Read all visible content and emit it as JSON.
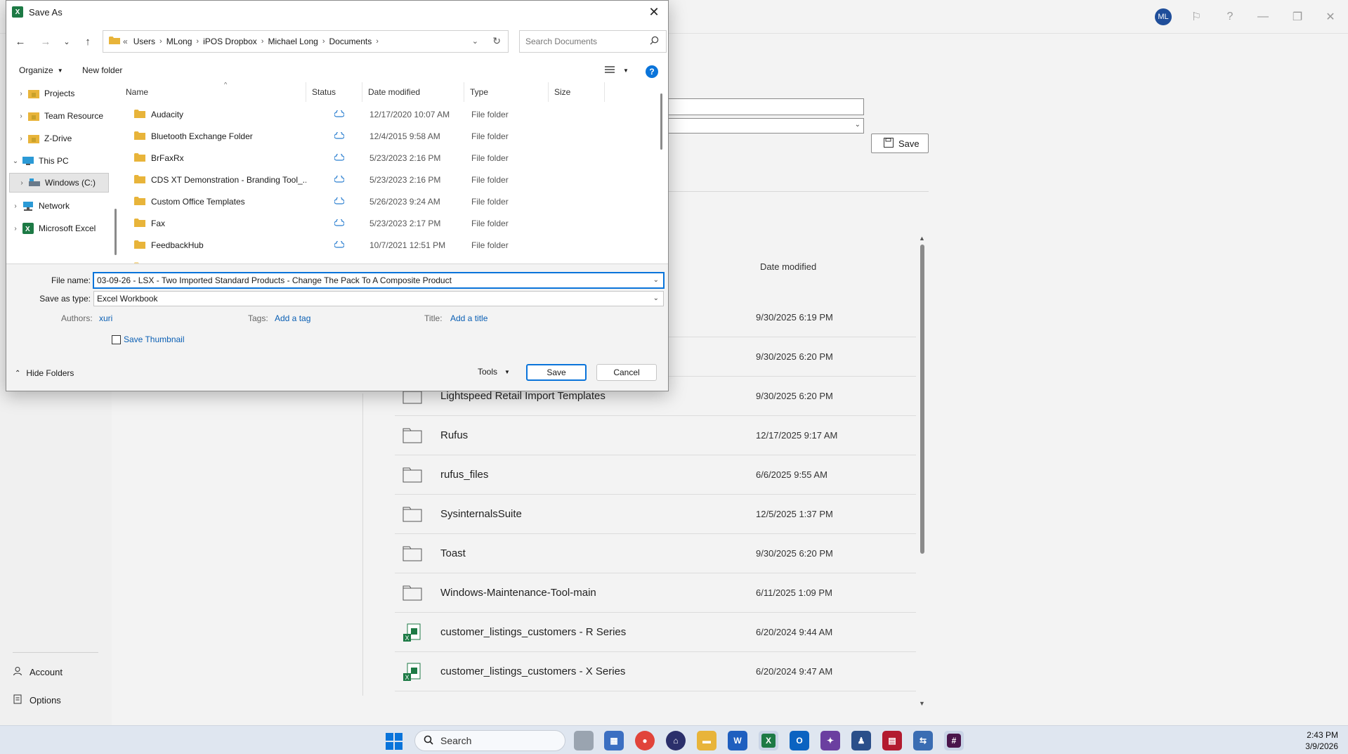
{
  "background": {
    "avatar_initials": "ML",
    "save_button": "Save",
    "date_header": "Date modified",
    "rows": [
      {
        "name": "",
        "date": "9/30/2025 6:19 PM",
        "icon": "folder-icon"
      },
      {
        "name": "",
        "date": "9/30/2025 6:20 PM",
        "icon": "folder-icon"
      },
      {
        "name": "Lightspeed Retail Import Templates",
        "date": "9/30/2025 6:20 PM",
        "icon": "folder-icon"
      },
      {
        "name": "Rufus",
        "date": "12/17/2025 9:17 AM",
        "icon": "folder-icon"
      },
      {
        "name": "rufus_files",
        "date": "6/6/2025 9:55 AM",
        "icon": "folder-icon"
      },
      {
        "name": "SysinternalsSuite",
        "date": "12/5/2025 1:37 PM",
        "icon": "folder-icon"
      },
      {
        "name": "Toast",
        "date": "9/30/2025 6:20 PM",
        "icon": "folder-icon"
      },
      {
        "name": "Windows-Maintenance-Tool-main",
        "date": "6/11/2025 1:09 PM",
        "icon": "folder-icon"
      },
      {
        "name": "customer_listings_customers - R Series",
        "date": "6/20/2024 9:44 AM",
        "icon": "excel-file-icon"
      },
      {
        "name": "customer_listings_customers - X Series",
        "date": "6/20/2024 9:47 AM",
        "icon": "excel-file-icon"
      }
    ],
    "nav": {
      "account": "Account",
      "options": "Options"
    }
  },
  "taskbar": {
    "search_label": "Search",
    "time": "2:43 PM",
    "date": "3/9/2026"
  },
  "dialog": {
    "title": "Save As",
    "breadcrumbs": [
      "Users",
      "MLong",
      "iPOS Dropbox",
      "Michael Long",
      "Documents"
    ],
    "breadcrumb_overflow": "«",
    "search_placeholder": "Search Documents",
    "toolbar": {
      "organize": "Organize",
      "new_folder": "New folder"
    },
    "nav_items": [
      {
        "label": "Projects",
        "icon": "folder-icon"
      },
      {
        "label": "Team Resource",
        "icon": "folder-icon"
      },
      {
        "label": "Z-Drive",
        "icon": "folder-icon"
      },
      {
        "label": "This PC",
        "icon": "pc-icon"
      },
      {
        "label": "Windows (C:)",
        "icon": "drive-icon"
      },
      {
        "label": "Network",
        "icon": "network-icon"
      },
      {
        "label": "Microsoft Excel",
        "icon": "excel-icon"
      }
    ],
    "columns": [
      "Name",
      "Status",
      "Date modified",
      "Type",
      "Size"
    ],
    "files": [
      {
        "name": "Audacity",
        "date": "12/17/2020 10:07 AM",
        "type": "File folder"
      },
      {
        "name": "Bluetooth Exchange Folder",
        "date": "12/4/2015 9:58 AM",
        "type": "File folder"
      },
      {
        "name": "BrFaxRx",
        "date": "5/23/2023 2:16 PM",
        "type": "File folder"
      },
      {
        "name": "CDS XT Demonstration - Branding Tool_...",
        "date": "5/23/2023 2:16 PM",
        "type": "File folder"
      },
      {
        "name": "Custom Office Templates",
        "date": "5/26/2023 9:24 AM",
        "type": "File folder"
      },
      {
        "name": "Fax",
        "date": "5/23/2023 2:17 PM",
        "type": "File folder"
      },
      {
        "name": "FeedbackHub",
        "date": "10/7/2021 12:51 PM",
        "type": "File folder"
      }
    ],
    "file_name_label": "File name:",
    "file_name_value": "03-09-26 - LSX - Two Imported Standard Products - Change The Pack To A Composite Product",
    "save_type_label": "Save as type:",
    "save_type_value": "Excel Workbook",
    "authors_label": "Authors:",
    "authors_value": "xuri",
    "tags_label": "Tags:",
    "tags_value": "Add a tag",
    "title_label": "Title:",
    "title_value": "Add a title",
    "thumbnail_label": "Save Thumbnail",
    "hide_folders": "Hide Folders",
    "tools": "Tools",
    "save": "Save",
    "cancel": "Cancel"
  }
}
